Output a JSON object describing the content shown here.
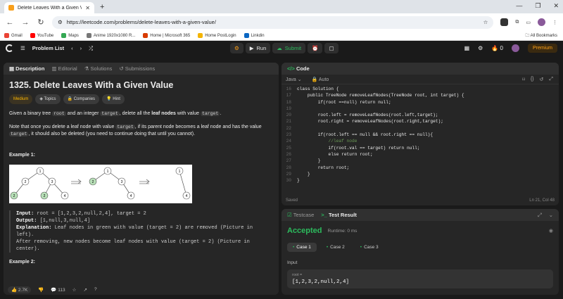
{
  "browser": {
    "tab_title": "Delete Leaves With a Given Va",
    "url": "https://leetcode.com/problems/delete-leaves-with-a-given-value/",
    "bookmarks": [
      "Gmail",
      "YouTube",
      "Maps",
      "Anime 1920x1080 R...",
      "Home | Microsoft 365",
      "Home PostLogin",
      "Linkdin"
    ],
    "all_bookmarks": "All Bookmarks"
  },
  "topbar": {
    "problem_list": "Problem List",
    "run": "Run",
    "submit": "Submit",
    "streak": "0",
    "premium": "Premium"
  },
  "left": {
    "tabs": [
      "Description",
      "Editorial",
      "Solutions",
      "Submissions"
    ],
    "title": "1325. Delete Leaves With a Given Value",
    "tags": [
      "Medium",
      "Topics",
      "Companies",
      "Hint"
    ],
    "p1": {
      "a": "Given a binary tree ",
      "c1": "root",
      "b": " and an integer ",
      "c2": "target",
      "c": ", delete all the ",
      "bold": "leaf nodes",
      "d": " with value ",
      "c3": "target",
      "e": "."
    },
    "p2": {
      "a": "Note that once you delete a leaf node with value ",
      "c1": "target",
      "b": ", if its parent node becomes a leaf node and has the value ",
      "c2": "target",
      "c": ", it should also be deleted (you need to continue doing that until you cannot)."
    },
    "example1": "Example 1:",
    "input_label": "Input:",
    "input_val": " root = [1,2,3,2,null,2,4], target = 2",
    "output_label": "Output:",
    "output_val": " [1,null,3,null,4]",
    "expl_label": "Explanation:",
    "expl_val": " Leaf nodes in green with value (target = 2) are removed (Picture in left).",
    "expl_2": "After removing, new nodes become leaf nodes with value (target = 2) (Picture in center).",
    "example2": "Example 2:",
    "likes": "2.7K",
    "comments": "113"
  },
  "code": {
    "header": "Code",
    "language": "Java",
    "autocomplete": "Auto",
    "status_saved": "Saved",
    "cursor": "Ln 21, Col 48",
    "lines": [
      {
        "n": "16",
        "t": "class Solution {"
      },
      {
        "n": "17",
        "t": "    public TreeNode removeLeafNodes(TreeNode root, int target) {"
      },
      {
        "n": "18",
        "t": "        if(root ==null) return null;"
      },
      {
        "n": "19",
        "t": ""
      },
      {
        "n": "20",
        "t": "        root.left = removeLeafNodes(root.left,target);"
      },
      {
        "n": "21",
        "t": "        root.right = removeLeafNodes(root.right,target);"
      },
      {
        "n": "22",
        "t": ""
      },
      {
        "n": "23",
        "t": "        if(root.left == null && root.right == null){"
      },
      {
        "n": "24",
        "t": "            //leaf node"
      },
      {
        "n": "25",
        "t": "            if(root.val == target) return null;"
      },
      {
        "n": "26",
        "t": "            else return root;"
      },
      {
        "n": "27",
        "t": "        }"
      },
      {
        "n": "28",
        "t": "        return root;"
      },
      {
        "n": "29",
        "t": "    }"
      },
      {
        "n": "30",
        "t": "}"
      }
    ]
  },
  "result": {
    "tab_testcase": "Testcase",
    "tab_result": "Test Result",
    "status": "Accepted",
    "runtime": "Runtime: 0 ms",
    "cases": [
      "Case 1",
      "Case 2",
      "Case 3"
    ],
    "input_heading": "Input",
    "root_label": "root =",
    "root_value": "[1,2,3,2,null,2,4]"
  },
  "colors": {
    "accent": "#ffa116",
    "accepted": "#2cbb5d",
    "highlight_leaf": "#b8e0b8"
  }
}
